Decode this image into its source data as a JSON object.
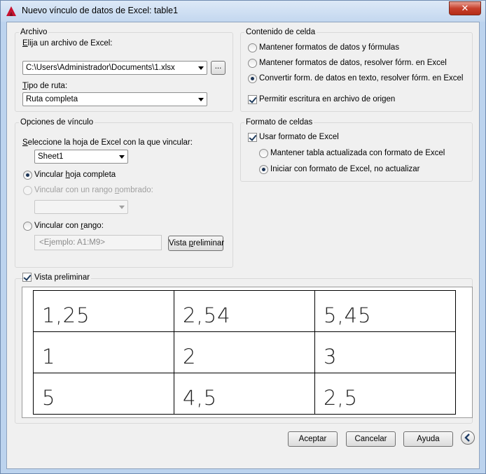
{
  "window": {
    "title": "Nuevo vínculo de datos de Excel: table1",
    "close_label": "✕"
  },
  "archivo": {
    "group_title": "Archivo",
    "choose_label_prefix": "E",
    "choose_label_rest": "lija un archivo de Excel:",
    "file_value": "C:\\Users\\Administrador\\Documents\\1.xlsx",
    "browse_label": "...",
    "path_type_prefix": "T",
    "path_type_rest": "ipo de ruta:",
    "path_type_value": "Ruta completa"
  },
  "opciones": {
    "group_title": "Opciones de vínculo",
    "select_sheet_prefix": "S",
    "select_sheet_rest": "eleccione la hoja de Excel con la que vincular:",
    "sheet_value": "Sheet1",
    "link_sheet_a": "Vincular ",
    "link_sheet_u": "h",
    "link_sheet_b": "oja completa",
    "link_named_a": "Vincular con un rango ",
    "link_named_u": "n",
    "link_named_b": "ombrado:",
    "link_range_a": "Vincular con ",
    "link_range_u": "r",
    "link_range_b": "ango:",
    "range_placeholder": "<Ejemplo: A1:M9>",
    "preview_btn_a": "Vista ",
    "preview_btn_u": "p",
    "preview_btn_b": "reliminar"
  },
  "contenido": {
    "group_title": "Contenido de celda",
    "opt1": "Mantener formatos de datos y fórmulas",
    "opt2": "Mantener formatos de datos, resolver fórm. en Excel",
    "opt3": "Convertir form. de datos en texto, resolver fórm. en Excel",
    "allow_write": "Permitir escritura en archivo de origen"
  },
  "formato": {
    "group_title": "Formato de celdas",
    "use_excel_format": "Usar formato de Excel",
    "keep_updated": "Mantener tabla actualizada con formato de Excel",
    "start_with": "Iniciar con formato de Excel, no actualizar"
  },
  "preview": {
    "label": "Vista preliminar",
    "rows": [
      [
        "1,25",
        "2,54",
        "5,45"
      ],
      [
        "1",
        "2",
        "3"
      ],
      [
        "5",
        "4,5",
        "2,5"
      ]
    ]
  },
  "footer": {
    "accept": "Aceptar",
    "cancel": "Cancelar",
    "help": "Ayuda"
  },
  "state": {
    "selected_content_option": 3,
    "allow_write_checked": true,
    "use_excel_format_checked": true,
    "selected_format_option": 2,
    "selected_link_option": 1,
    "preview_checked": true
  }
}
